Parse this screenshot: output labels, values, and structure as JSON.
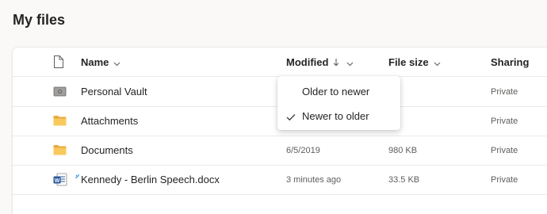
{
  "page": {
    "title": "My files"
  },
  "columns": {
    "name": "Name",
    "modified": "Modified",
    "file_size": "File size",
    "sharing": "Sharing"
  },
  "sort_menu": {
    "items": [
      {
        "label": "Older to newer",
        "selected": false
      },
      {
        "label": "Newer to older",
        "selected": true
      }
    ]
  },
  "rows": [
    {
      "name": "Personal Vault",
      "modified": "",
      "file_size": "",
      "sharing": "Private",
      "icon": "vault-icon"
    },
    {
      "name": "Attachments",
      "modified": "",
      "file_size": "",
      "sharing": "Private",
      "icon": "folder-icon"
    },
    {
      "name": "Documents",
      "modified": "6/5/2019",
      "file_size": "980 KB",
      "sharing": "Private",
      "icon": "folder-icon"
    },
    {
      "name": "Kennedy - Berlin Speech.docx",
      "modified": "3 minutes ago",
      "file_size": "33.5 KB",
      "sharing": "Private",
      "icon": "word-document-icon"
    }
  ],
  "colors": {
    "folder": "#f8c95c",
    "word_blue": "#2b579a",
    "accent": "#0078d4"
  }
}
